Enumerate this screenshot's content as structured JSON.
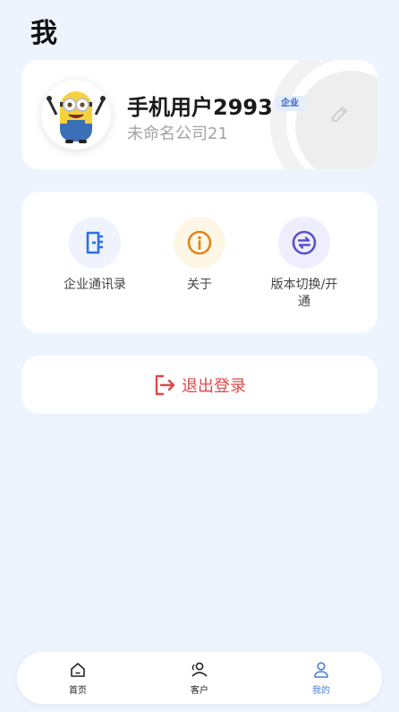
{
  "page": {
    "title": "我"
  },
  "profile": {
    "name": "手机用户2993",
    "badge": "企业",
    "company": "未命名公司21"
  },
  "menu": {
    "items": [
      {
        "label": "企业通讯录",
        "icon": "contact-book-icon",
        "color": "#2f6fe6",
        "bg": "#eef3fe"
      },
      {
        "label": "关于",
        "icon": "info-icon",
        "color": "#e0851a",
        "bg": "#fff7e6"
      },
      {
        "label": "版本切换/开通",
        "icon": "switch-icon",
        "color": "#5a4fcf",
        "bg": "#eeeefe"
      }
    ]
  },
  "logout": {
    "label": "退出登录",
    "color": "#e04848"
  },
  "tabbar": {
    "items": [
      {
        "label": "首页",
        "icon": "home-icon"
      },
      {
        "label": "客户",
        "icon": "customers-icon"
      },
      {
        "label": "我的",
        "icon": "profile-icon",
        "active": true
      }
    ]
  }
}
